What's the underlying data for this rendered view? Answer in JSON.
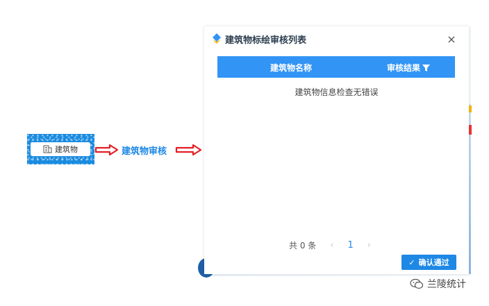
{
  "left_flow": {
    "building_button_label": "建筑物",
    "step_label": "建筑物审核"
  },
  "modal": {
    "title": "建筑物标绘审核列表",
    "close_label": "×",
    "table": {
      "columns": [
        "建筑物名称",
        "审核结果"
      ]
    },
    "empty_message": "建筑物信息检查无错误",
    "pagination": {
      "total_text": "共 0 条",
      "prev": "‹",
      "current_page": "1",
      "next": "›"
    },
    "confirm_button": "确认通过"
  },
  "watermark": {
    "text": "兰陵统计"
  },
  "colors": {
    "accent": "#1e88e5",
    "header_bg": "#3294f5",
    "arrow_red": "#e31e24"
  },
  "icons": {
    "building": "building-icon",
    "filter": "filter-icon",
    "close": "close-icon",
    "check": "check-icon",
    "app": "app-logo-icon",
    "wechat": "wechat-icon"
  }
}
